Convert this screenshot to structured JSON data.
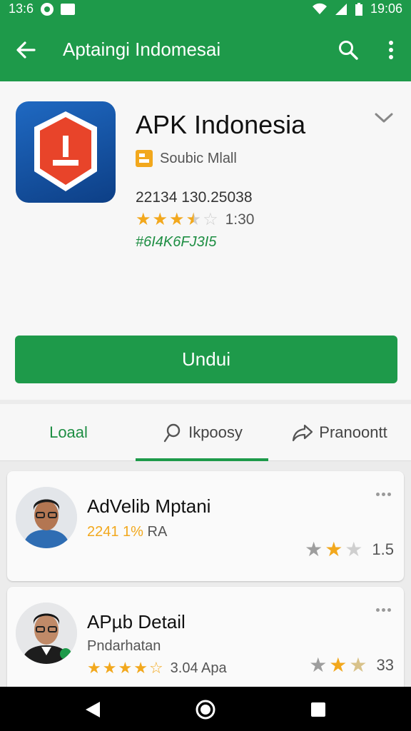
{
  "status_bar": {
    "time_left": "13:6",
    "time_right": "19:06"
  },
  "app_bar": {
    "title": "Aptaingi Indomesai"
  },
  "app": {
    "name": "APK Indonesia",
    "developer": "Soubic Mlall",
    "stats": "22134 130.25038",
    "rating_value": "1:30",
    "rating_stars": 3.5,
    "tag": "#6I4K6FJ3I5"
  },
  "install_button": {
    "label": "Undui"
  },
  "tabs": [
    {
      "label": "Loaal",
      "icon": "none",
      "selected": true
    },
    {
      "label": "Ikpoosy",
      "icon": "person-icon",
      "selected": false
    },
    {
      "label": "Pranoontt",
      "icon": "share-icon",
      "selected": false
    }
  ],
  "reviews": [
    {
      "name": "AdVelib Mptani",
      "subtitle_highlight": "2241 1%",
      "subtitle_rest": "RA",
      "stars_right": 2,
      "rating_right": "1.5"
    },
    {
      "name": "APµb Detail",
      "subtitle": "Pndarhatan",
      "stars_left": 4.5,
      "rating_left": "3.04 Apa",
      "stars_right": 2.5,
      "rating_right": "33"
    }
  ],
  "colors": {
    "primary": "#1e9a4a",
    "accent_star": "#f2a81d",
    "icon_red": "#e8442a",
    "icon_blue": "#1f69c2"
  }
}
